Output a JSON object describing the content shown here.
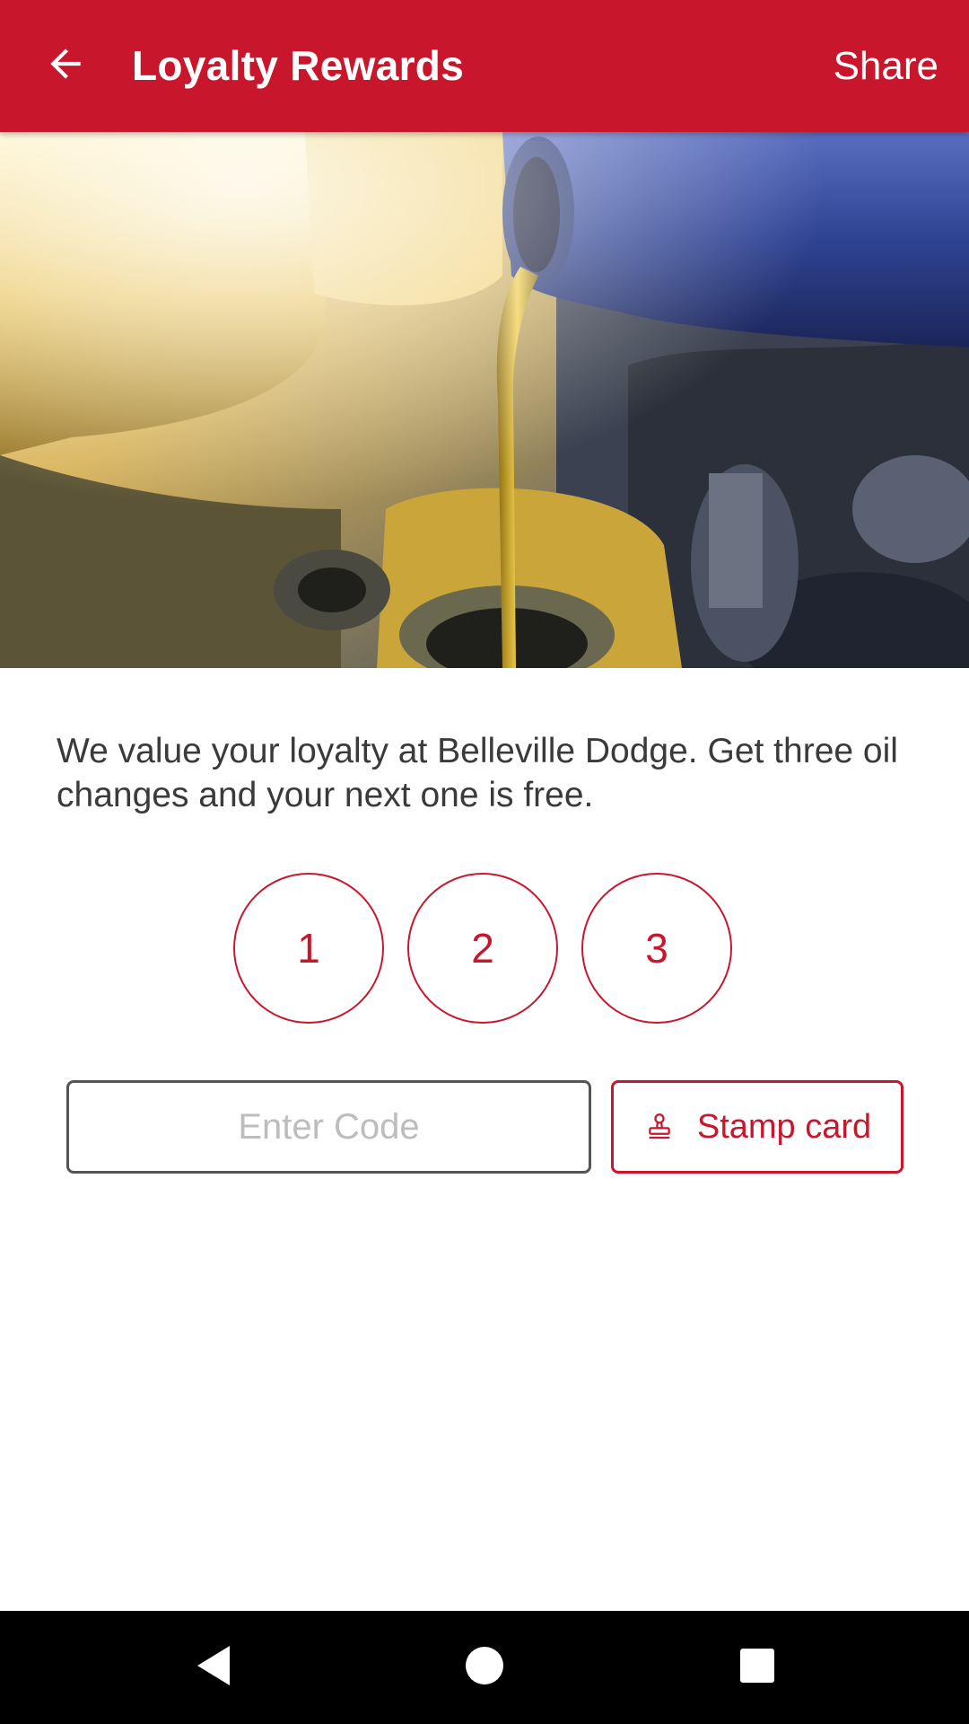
{
  "app_bar": {
    "title": "Loyalty Rewards",
    "share_label": "Share",
    "back_icon": "arrow-back-icon",
    "background_color": "#c8172d"
  },
  "hero": {
    "image_subject": "oil pouring into engine"
  },
  "description": "We value your loyalty at Belleville Dodge. Get three oil changes and your next one is free.",
  "stamps": [
    "1",
    "2",
    "3"
  ],
  "code_entry": {
    "placeholder": "Enter Code",
    "value": ""
  },
  "stamp_button": {
    "label": "Stamp card",
    "icon": "stamp-icon"
  },
  "nav_bar": {
    "back_icon": "nav-back-icon",
    "home_icon": "nav-home-icon",
    "recents_icon": "nav-recents-icon"
  },
  "colors": {
    "accent": "#c8172d",
    "text": "#3a3a3a",
    "placeholder": "#bdbdbd"
  }
}
